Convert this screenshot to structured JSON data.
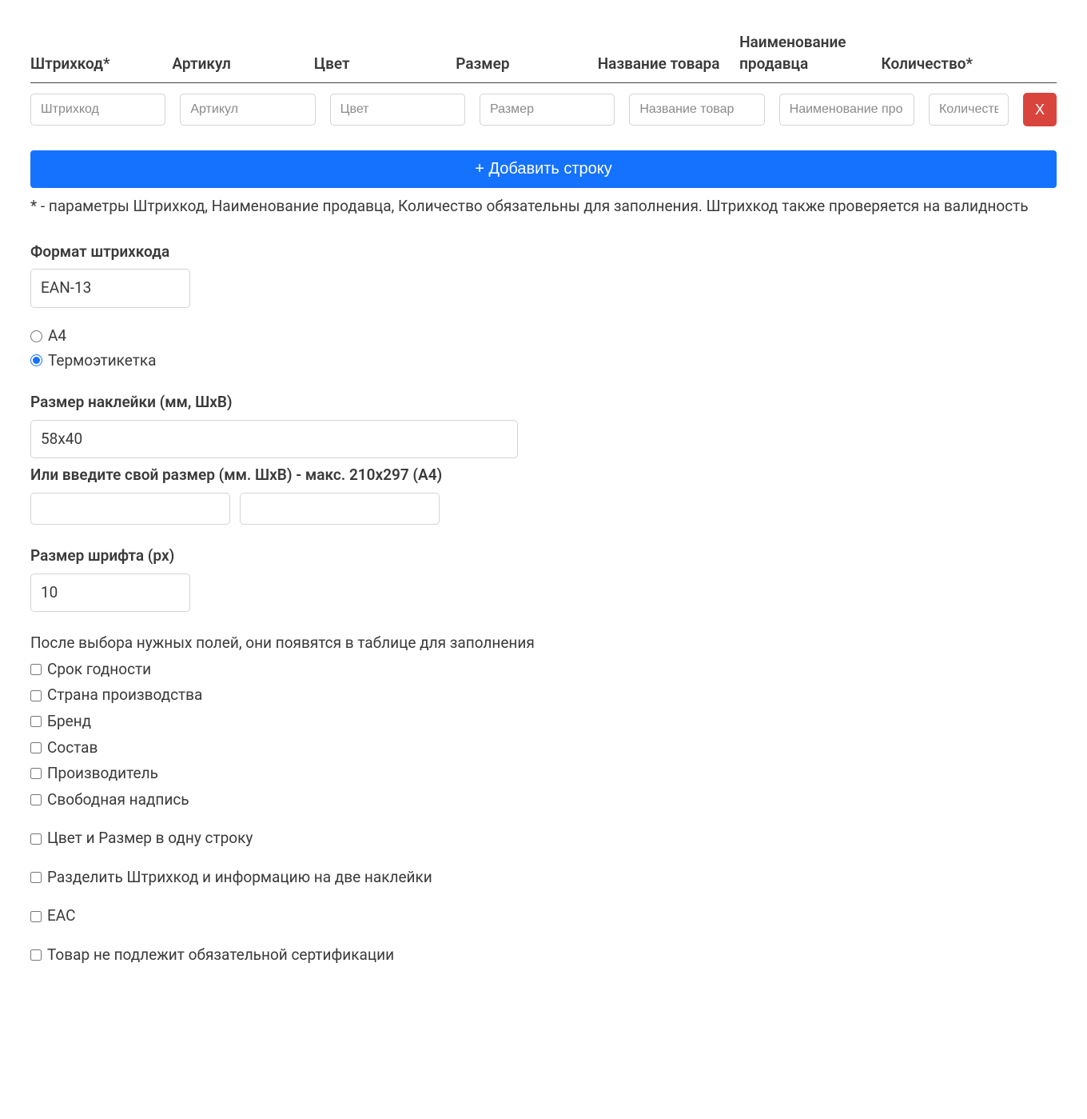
{
  "table": {
    "headers": {
      "barcode": "Штрихкод*",
      "article": "Артикул",
      "color": "Цвет",
      "size": "Размер",
      "product_name": "Название товара",
      "seller_name": "Наименование продавца",
      "quantity": "Количество*"
    },
    "placeholders": {
      "barcode": "Штрихкод",
      "article": "Артикул",
      "color": "Цвет",
      "size": "Размер",
      "product_name": "Название товар",
      "seller_name": "Наименование про",
      "quantity": "Количеств"
    },
    "delete_label": "X"
  },
  "buttons": {
    "add_row": "+ Добавить строку"
  },
  "note_text": "* - параметры Штрихкод, Наименование продавца, Количество обязательны для заполнения. Штрихкод также проверяется на валидность",
  "barcode_format": {
    "label": "Формат штрихкода",
    "value": "EAN-13"
  },
  "print_type": {
    "options": {
      "a4": "А4",
      "thermal": "Термоэтикетка"
    },
    "selected": "thermal"
  },
  "label_size": {
    "label": "Размер наклейки (мм, ШхВ)",
    "value": "58x40"
  },
  "custom_size": {
    "label": "Или введите свой размер (мм. ШхВ) - макс. 210x297 (А4)"
  },
  "font_size": {
    "label": "Размер шрифта (px)",
    "value": "10"
  },
  "fields_helper": "После выбора нужных полей, они появятся в таблице для заполнения",
  "checkboxes": {
    "expiry": "Срок годности",
    "country": "Страна производства",
    "brand": "Бренд",
    "composition": "Состав",
    "manufacturer": "Производитель",
    "free_text": "Свободная надпись",
    "color_size_one_line": "Цвет и Размер в одну строку",
    "split_labels": "Разделить Штрихкод и информацию на две наклейки",
    "eac": "EAC",
    "no_cert": "Товар не подлежит обязательной сертификации"
  }
}
